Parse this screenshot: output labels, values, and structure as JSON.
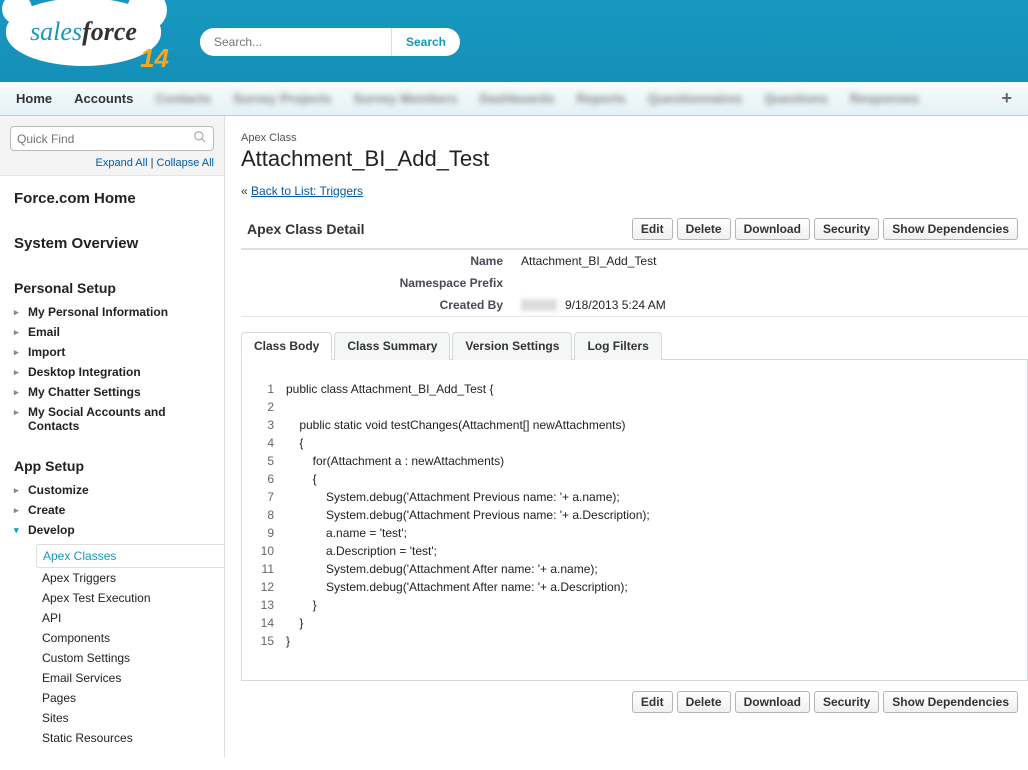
{
  "header": {
    "logo_prefix": "sales",
    "logo_suffix": "force",
    "logo_num": "14",
    "search_placeholder": "Search...",
    "search_btn": "Search"
  },
  "nav": {
    "home": "Home",
    "accounts": "Accounts",
    "b1": "Contacts",
    "b2": "Survey Projects",
    "b3": "Survey Members",
    "b4": "Dashboards",
    "b5": "Reports",
    "b6": "Questionnaires",
    "b7": "Questions",
    "b8": "Responses",
    "plus": "+"
  },
  "sidebar": {
    "quick_find": "Quick Find",
    "expand": "Expand All",
    "collapse": "Collapse All",
    "sep": " | ",
    "force_home": "Force.com Home",
    "sys_overview": "System Overview",
    "personal": {
      "title": "Personal Setup",
      "items": [
        "My Personal Information",
        "Email",
        "Import",
        "Desktop Integration",
        "My Chatter Settings",
        "My Social Accounts and Contacts"
      ]
    },
    "app": {
      "title": "App Setup",
      "customize": "Customize",
      "create": "Create",
      "develop": "Develop",
      "dev_items": [
        "Apex Classes",
        "Apex Triggers",
        "Apex Test Execution",
        "API",
        "Components",
        "Custom Settings",
        "Email Services",
        "Pages",
        "Sites",
        "Static Resources"
      ]
    }
  },
  "main": {
    "crumb": "Apex Class",
    "title": "Attachment_BI_Add_Test",
    "back_prefix": "« ",
    "back_link": "Back to List: Triggers",
    "detail_title": "Apex Class Detail",
    "buttons": {
      "edit": "Edit",
      "delete": "Delete",
      "download": "Download",
      "security": "Security",
      "showdep": "Show Dependencies"
    },
    "fields": {
      "name_lbl": "Name",
      "name_val": "Attachment_BI_Add_Test",
      "ns_lbl": "Namespace Prefix",
      "ns_val": "",
      "created_lbl": "Created By",
      "created_date": "9/18/2013 5:24 AM"
    },
    "tabs": {
      "body": "Class Body",
      "summary": "Class Summary",
      "version": "Version Settings",
      "log": "Log Filters"
    },
    "code": [
      "public class Attachment_BI_Add_Test {",
      "",
      "    public static void testChanges(Attachment[] newAttachments)",
      "    {",
      "        for(Attachment a : newAttachments)",
      "        {",
      "            System.debug('Attachment Previous name: '+ a.name);",
      "            System.debug('Attachment Previous name: '+ a.Description);",
      "            a.name = 'test';",
      "            a.Description = 'test';",
      "            System.debug('Attachment After name: '+ a.name);",
      "            System.debug('Attachment After name: '+ a.Description);",
      "        }",
      "    }",
      "}"
    ]
  }
}
